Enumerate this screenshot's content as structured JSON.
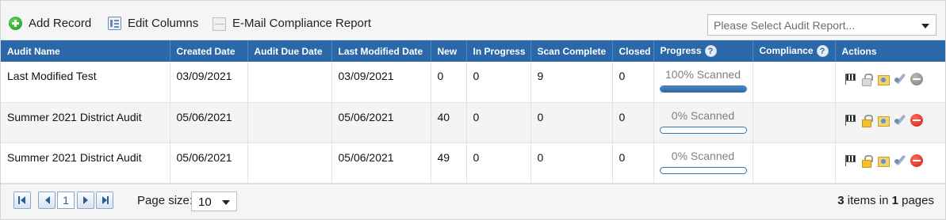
{
  "toolbar": {
    "add_record": "Add Record",
    "edit_columns": "Edit Columns",
    "email_report": "E-Mail Compliance Report",
    "audit_report_placeholder": "Please Select Audit Report..."
  },
  "columns": [
    "Audit Name",
    "Created Date",
    "Audit Due Date",
    "Last Modified Date",
    "New",
    "In Progress",
    "Scan Complete",
    "Closed",
    "Progress",
    "Compliance",
    "Actions"
  ],
  "help_glyph": "?",
  "rows": [
    {
      "audit_name": "Last Modified Test",
      "created_date": "03/09/2021",
      "due_date": "",
      "last_modified": "03/09/2021",
      "new": "0",
      "in_progress": "0",
      "scan_complete": "9",
      "closed": "0",
      "progress_label": "100% Scanned",
      "progress_fraction": 1.0,
      "compliance": "",
      "close_icon_state": "inactive",
      "lock_state": "inactive"
    },
    {
      "audit_name": "Summer 2021 District Audit",
      "created_date": "05/06/2021",
      "due_date": "",
      "last_modified": "05/06/2021",
      "new": "40",
      "in_progress": "0",
      "scan_complete": "0",
      "closed": "0",
      "progress_label": "0% Scanned",
      "progress_fraction": 0.0,
      "compliance": "",
      "close_icon_state": "active",
      "lock_state": "active"
    },
    {
      "audit_name": "Summer 2021 District Audit",
      "created_date": "05/06/2021",
      "due_date": "",
      "last_modified": "05/06/2021",
      "new": "49",
      "in_progress": "0",
      "scan_complete": "0",
      "closed": "0",
      "progress_label": "0% Scanned",
      "progress_fraction": 0.0,
      "compliance": "",
      "close_icon_state": "active",
      "lock_state": "active"
    }
  ],
  "pager": {
    "current_page": "1",
    "page_size_label": "Page size:",
    "page_size": "10",
    "items_count": "3",
    "items_text": " items in ",
    "pages_count": "1",
    "pages_text": " pages"
  },
  "colors": {
    "header_bg": "#2b68a9",
    "progress_fill": "#2f67a3",
    "stop_active": "#d01f10"
  }
}
